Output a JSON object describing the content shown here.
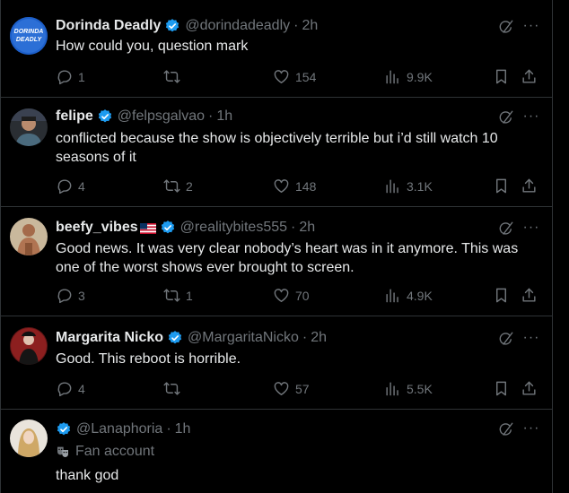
{
  "posts": [
    {
      "name": "Dorinda Deadly",
      "handle": "@dorindadeadly",
      "time": "2h",
      "text": "How could you, question mark",
      "replies": "1",
      "reposts": "",
      "likes": "154",
      "views": "9.9K",
      "avatar_text": "DORINDA DEADLY"
    },
    {
      "name": "felipe",
      "handle": "@felpsgalvao",
      "time": "1h",
      "text": "conflicted because the show is objectively terrible but i’d still watch 10 seasons of it",
      "replies": "4",
      "reposts": "2",
      "likes": "148",
      "views": "3.1K"
    },
    {
      "name": "beefy_vibes",
      "handle": "@realitybites555",
      "time": "2h",
      "text": "Good news. It was very clear nobody’s heart was in it anymore. This was one of the worst shows ever brought to screen.",
      "replies": "3",
      "reposts": "1",
      "likes": "70",
      "views": "4.9K"
    },
    {
      "name": "Margarita Nicko",
      "handle": "@MargaritaNicko",
      "time": "2h",
      "text": "Good. This reboot is horrible.",
      "replies": "4",
      "reposts": "",
      "likes": "57",
      "views": "5.5K"
    },
    {
      "name": "",
      "handle": "@Lanaphoria",
      "time": "1h",
      "sublabel": "Fan account",
      "text": "thank god"
    }
  ],
  "separator": "·",
  "more_glyph": "···",
  "colors": {
    "background": "#000000",
    "text": "#e7e9ea",
    "secondary": "#71767b",
    "verified": "#1d9bf0",
    "divider": "#2f3336"
  }
}
